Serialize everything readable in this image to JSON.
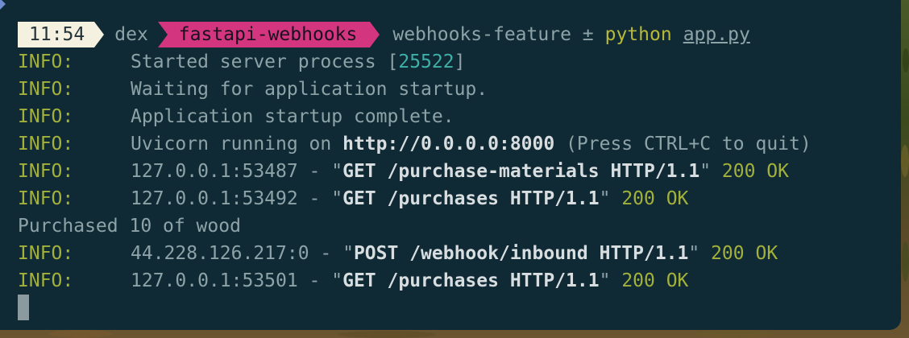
{
  "prompt": {
    "time": "11:54",
    "user": "dex",
    "directory": "fastapi-webhooks",
    "branch": "webhooks-feature ±",
    "command": "python",
    "argument": "app.py"
  },
  "log": [
    {
      "level": "INFO:",
      "text": "Started server process [",
      "pid": "25522",
      "tail": "]"
    },
    {
      "level": "INFO:",
      "text": "Waiting for application startup."
    },
    {
      "level": "INFO:",
      "text": "Application startup complete."
    },
    {
      "level": "INFO:",
      "text": "Uvicorn running on ",
      "url": "http://0.0.0.0:8000",
      "tail": " (Press CTRL+C to quit)"
    },
    {
      "level": "INFO:",
      "addr": "127.0.0.1:53487 - \"",
      "request": "GET /purchase-materials HTTP/1.1",
      "quote": "\" ",
      "status": "200 OK"
    },
    {
      "level": "INFO:",
      "addr": "127.0.0.1:53492 - \"",
      "request": "GET /purchases HTTP/1.1",
      "quote": "\" ",
      "status": "200 OK"
    },
    {
      "plain": "Purchased 10 of wood"
    },
    {
      "level": "INFO:",
      "addr": "44.228.126.217:0 - \"",
      "request": "POST /webhook/inbound HTTP/1.1",
      "quote": "\" ",
      "status": "200 OK"
    },
    {
      "level": "INFO:",
      "addr": "127.0.0.1:53501 - \"",
      "request": "GET /purchases HTTP/1.1",
      "quote": "\" ",
      "status": "200 OK"
    }
  ],
  "colors": {
    "terminal_bg": "#0f2a35",
    "level": "#a3b13a",
    "text": "#8ea3a8",
    "pid": "#3fb0a8",
    "dir_segment": "#d3367e",
    "time_segment": "#f4f1e1"
  }
}
